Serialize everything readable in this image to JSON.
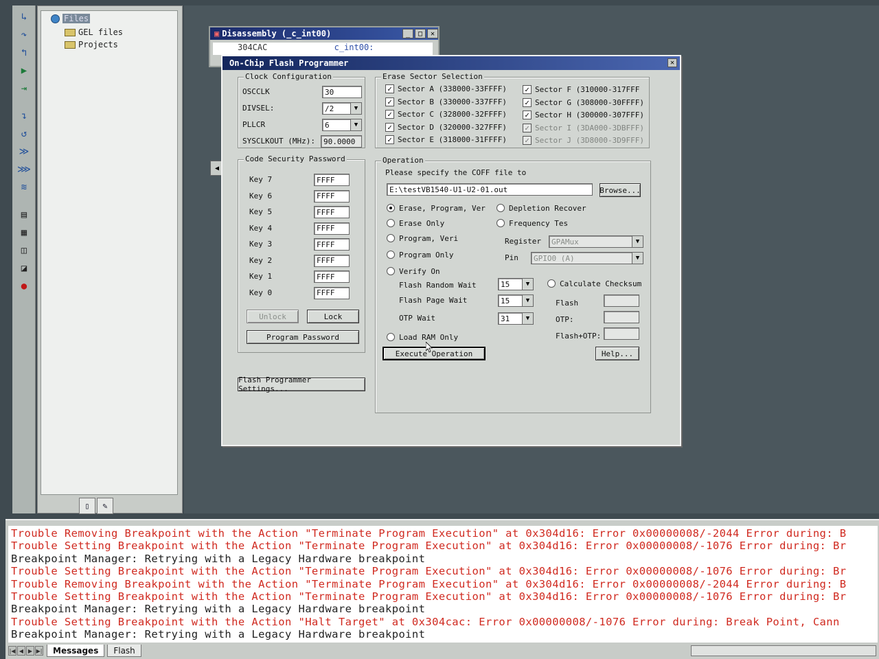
{
  "toolbar": {
    "icons": [
      "step-into-icon",
      "step-over-icon",
      "step-out-icon",
      "run-icon",
      "run-to-cursor-icon",
      "step-asm-icon",
      "step-back-icon",
      "animate-icon",
      "multi-run-icon",
      "run-free-icon",
      "memory-icon",
      "registers-icon",
      "watch-icon",
      "graph-icon",
      "breakpoint-icon"
    ]
  },
  "explorer": {
    "root_label": "Files",
    "items": [
      {
        "label": "GEL files"
      },
      {
        "label": "Projects"
      }
    ]
  },
  "disassembly": {
    "title": "Disassembly (_c_int00)",
    "address": "304CAC",
    "symbol": "c_int00:"
  },
  "dialog": {
    "title": "On-Chip Flash Programmer",
    "close_label": "✕",
    "clock": {
      "group_title": "Clock Configuration",
      "oscclk_label": "OSCCLK",
      "oscclk_value": "30",
      "divsel_label": "DIVSEL:",
      "divsel_value": "/2",
      "pllcr_label": "PLLCR",
      "pllcr_value": "6",
      "sysclkout_label": "SYSCLKOUT (MHz):",
      "sysclkout_value": "90.0000"
    },
    "erase": {
      "group_title": "Erase Sector Selection",
      "sectors_left": [
        {
          "label": "Sector A (338000-33FFFF)",
          "checked": true
        },
        {
          "label": "Sector B (330000-337FFF)",
          "checked": true
        },
        {
          "label": "Sector C (328000-32FFFF)",
          "checked": true
        },
        {
          "label": "Sector D (320000-327FFF)",
          "checked": true
        },
        {
          "label": "Sector E (318000-31FFFF)",
          "checked": true
        }
      ],
      "sectors_right": [
        {
          "label": "Sector F (310000-317FFF",
          "checked": true
        },
        {
          "label": "Sector G (308000-30FFFF)",
          "checked": true
        },
        {
          "label": "Sector H (300000-307FFF)",
          "checked": true
        },
        {
          "label": "Sector I (3DA000-3DBFFF)",
          "checked": true,
          "disabled": true
        },
        {
          "label": "Sector J (3D8000-3D9FFF)",
          "checked": true,
          "disabled": true
        }
      ]
    },
    "password": {
      "group_title": "Code Security Password",
      "keys": [
        {
          "label": "Key 7",
          "value": "FFFF"
        },
        {
          "label": "Key 6",
          "value": "FFFF"
        },
        {
          "label": "Key 5",
          "value": "FFFF"
        },
        {
          "label": "Key 4",
          "value": "FFFF"
        },
        {
          "label": "Key 3",
          "value": "FFFF"
        },
        {
          "label": "Key 2",
          "value": "FFFF"
        },
        {
          "label": "Key 1",
          "value": "FFFF"
        },
        {
          "label": "Key 0",
          "value": "FFFF"
        }
      ],
      "unlock_label": "Unlock",
      "lock_label": "Lock",
      "program_password_label": "Program Password"
    },
    "settings_button": "Flash Programmer Settings...",
    "operation": {
      "group_title": "Operation",
      "coff_prompt": "Please specify the COFF file to",
      "coff_path": "E:\\testVB1540-U1-U2-01.out",
      "browse_label": "Browse...",
      "modes_left": [
        {
          "label": "Erase, Program, Ver",
          "selected": true
        },
        {
          "label": "Erase Only",
          "selected": false
        },
        {
          "label": "Program, Veri",
          "selected": false
        },
        {
          "label": "Program Only",
          "selected": false
        },
        {
          "label": "Verify On",
          "selected": false
        }
      ],
      "modes_right": [
        {
          "label": "Depletion Recover",
          "selected": false
        },
        {
          "label": "Frequency Tes",
          "selected": false
        }
      ],
      "register_label": "Register",
      "register_value": "GPAMux",
      "pin_label": "Pin",
      "pin_value": "GPIO0 (A)",
      "flash_random_wait_label": "Flash Random Wait",
      "flash_random_wait_value": "15",
      "flash_page_wait_label": "Flash Page Wait",
      "flash_page_wait_value": "15",
      "otp_wait_label": "OTP Wait",
      "otp_wait_value": "31",
      "calc_checksum_label": "Calculate Checksum",
      "flash_label": "Flash",
      "otp_label": "OTP:",
      "flash_otp_label": "Flash+OTP:",
      "load_ram_label": "Load RAM Only",
      "execute_label": "Execute Operation",
      "help_label": "Help..."
    }
  },
  "output": {
    "lines": [
      {
        "text": "Trouble Removing Breakpoint with the Action \"Terminate Program Execution\" at 0x304d16: Error 0x00000008/-2044 Error during: B",
        "kind": "err"
      },
      {
        "text": "Trouble Setting Breakpoint with the Action \"Terminate Program Execution\" at 0x304d16: Error 0x00000008/-1076 Error during: Br",
        "kind": "err"
      },
      {
        "text": "Breakpoint Manager: Retrying with a Legacy Hardware breakpoint",
        "kind": "ok"
      },
      {
        "text": "Trouble Setting Breakpoint with the Action \"Terminate Program Execution\" at 0x304d16: Error 0x00000008/-1076 Error during: Br",
        "kind": "err"
      },
      {
        "text": "Trouble Removing Breakpoint with the Action \"Terminate Program Execution\" at 0x304d16: Error 0x00000008/-2044 Error during: B",
        "kind": "err"
      },
      {
        "text": "Trouble Setting Breakpoint with the Action \"Terminate Program Execution\" at 0x304d16: Error 0x00000008/-1076 Error during: Br",
        "kind": "err"
      },
      {
        "text": "Breakpoint Manager: Retrying with a Legacy Hardware breakpoint",
        "kind": "ok"
      },
      {
        "text": "Trouble Setting Breakpoint with the Action \"Halt Target\" at 0x304cac: Error 0x00000008/-1076 Error during: Break Point,  Cann",
        "kind": "err"
      },
      {
        "text": "Breakpoint Manager: Retrying with a Legacy Hardware breakpoint",
        "kind": "ok"
      }
    ],
    "tabs": [
      {
        "label": "Messages",
        "active": true
      },
      {
        "label": "Flash",
        "active": false
      }
    ]
  }
}
